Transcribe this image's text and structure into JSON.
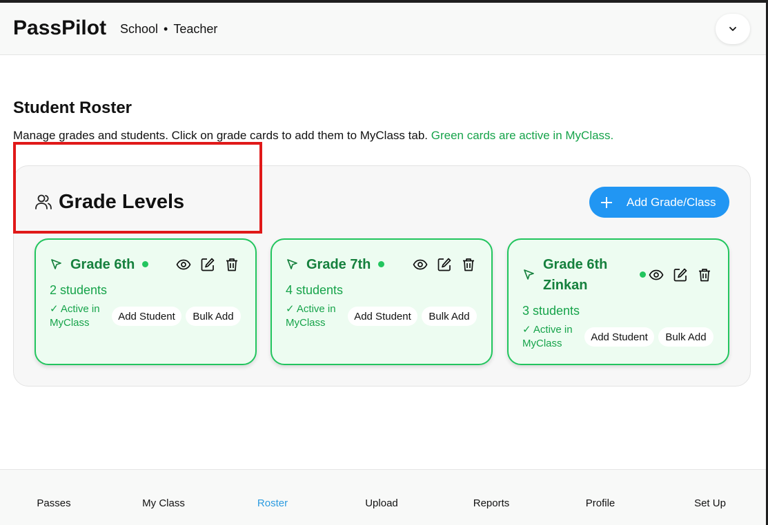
{
  "app": {
    "name": "PassPilot",
    "context_school": "School",
    "context_separator": "•",
    "context_role": "Teacher",
    "menu_icon": "chevron-down-icon"
  },
  "page": {
    "title": "Student Roster",
    "description": "Manage grades and students. Click on grade cards to add them to MyClass tab.",
    "description_highlight": "Green cards are active in MyClass."
  },
  "grade_levels": {
    "title": "Grade Levels",
    "icon": "users-icon",
    "add_button_label": "Add Grade/Class",
    "cards": [
      {
        "name": "Grade 6th",
        "count": "2 students",
        "active_label": "✓ Active in MyClass",
        "add_student_label": "Add Student",
        "bulk_add_label": "Bulk Add"
      },
      {
        "name": "Grade 7th",
        "count": "4 students",
        "active_label": "✓ Active in MyClass",
        "add_student_label": "Add Student",
        "bulk_add_label": "Bulk Add"
      },
      {
        "name": "Grade 6th Zinkan",
        "count": "3 students",
        "active_label": "✓ Active in MyClass",
        "add_student_label": "Add Student",
        "bulk_add_label": "Bulk Add"
      }
    ]
  },
  "nav": {
    "items": [
      {
        "label": "Passes"
      },
      {
        "label": "My Class"
      },
      {
        "label": "Roster"
      },
      {
        "label": "Upload"
      },
      {
        "label": "Reports"
      },
      {
        "label": "Profile"
      },
      {
        "label": "Set Up"
      }
    ],
    "active": "Roster"
  },
  "colors": {
    "accent_green": "#16a34a",
    "card_border": "#22c55e",
    "primary_blue": "#2196f3",
    "active_nav": "#2b9be0",
    "highlight_red": "#e01919"
  }
}
